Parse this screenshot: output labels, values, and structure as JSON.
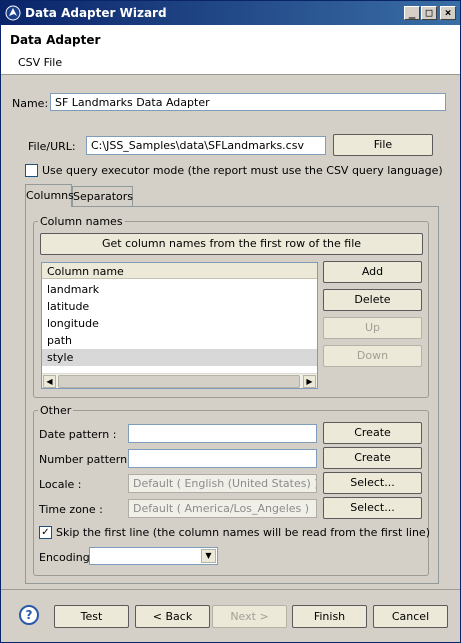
{
  "window": {
    "title": "Data Adapter Wizard"
  },
  "header": {
    "title": "Data Adapter",
    "subtitle": "CSV File"
  },
  "form": {
    "name_label": "Name:",
    "name_value": "SF Landmarks Data Adapter",
    "file_label": "File/URL:",
    "file_value": "C:\\JSS_Samples\\data\\SFLandmarks.csv",
    "file_button": "File",
    "query_mode_label": "Use query executor mode (the report must use the CSV query language)",
    "query_mode_checked": false
  },
  "tabs": [
    {
      "label": "Columns",
      "active": true
    },
    {
      "label": "Separators",
      "active": false
    }
  ],
  "column_names": {
    "group_title": "Column names",
    "get_names_button": "Get column names from the first row of the file",
    "header": "Column name",
    "rows": [
      "landmark",
      "latitude",
      "longitude",
      "path",
      "style"
    ],
    "add_button": "Add",
    "delete_button": "Delete",
    "up_button": "Up",
    "down_button": "Down"
  },
  "other": {
    "group_title": "Other",
    "date_pattern_label": "Date pattern :",
    "date_pattern_value": "",
    "date_create_button": "Create",
    "number_pattern_label": "Number pattern :",
    "number_pattern_value": "",
    "number_create_button": "Create",
    "locale_label": "Locale :",
    "locale_value": "Default ( English (United States) )",
    "locale_button": "Select...",
    "timezone_label": "Time zone :",
    "timezone_value": "Default ( America/Los_Angeles )",
    "timezone_button": "Select...",
    "skip_first_line_label": "Skip the first line (the column names will be read from the first line)",
    "skip_first_line_checked": true,
    "encoding_label": "Encoding",
    "encoding_value": ""
  },
  "footer": {
    "help": "?",
    "test": "Test",
    "back": "< Back",
    "next": "Next >",
    "finish": "Finish",
    "cancel": "Cancel"
  },
  "icons": {
    "check": "✓",
    "arrow_left": "◀",
    "arrow_right": "▶",
    "arrow_down": "▼",
    "minimize": "_",
    "maximize": "□",
    "close": "×"
  }
}
